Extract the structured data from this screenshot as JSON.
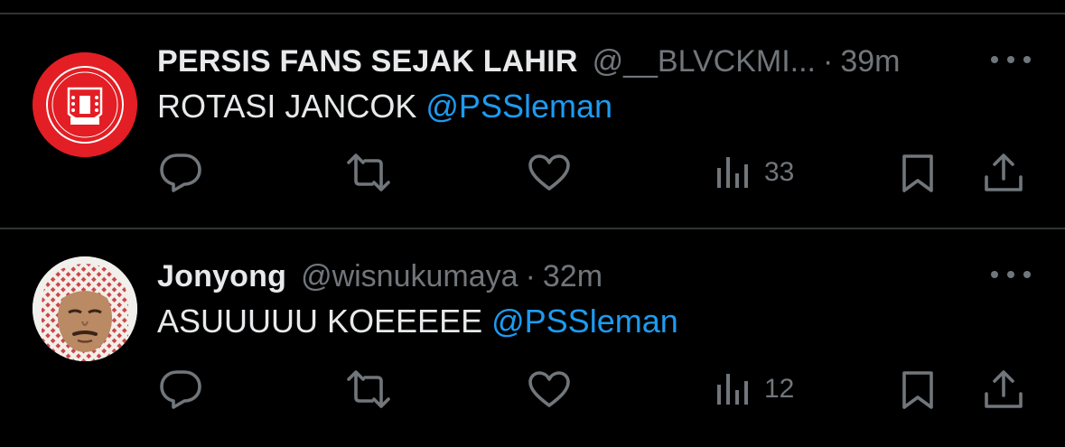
{
  "tweets": [
    {
      "display_name": "PERSIS FANS SEJAK LAHIR",
      "handle": "@__BLVCKMI...",
      "separator": "·",
      "time": "39m",
      "text": "ROTASI JANCOK",
      "mention": "@PSSleman",
      "views": "33",
      "avatar_icon": "persis-logo-icon",
      "avatar_color": "#e31e24"
    },
    {
      "display_name": "Jonyong",
      "handle": "@wisnukumaya",
      "separator": "·",
      "time": "32m",
      "text": "ASUUUUU KOEEEEE",
      "mention": "@PSSleman",
      "views": "12",
      "avatar_icon": "user-photo-avatar"
    }
  ],
  "colors": {
    "background": "#000000",
    "text": "#e7e9ea",
    "secondary": "#71767b",
    "link": "#1d9bf0",
    "divider": "#2f3336"
  },
  "icons": [
    "reply-icon",
    "retweet-icon",
    "like-icon",
    "views-icon",
    "bookmark-icon",
    "share-icon",
    "more-icon"
  ]
}
